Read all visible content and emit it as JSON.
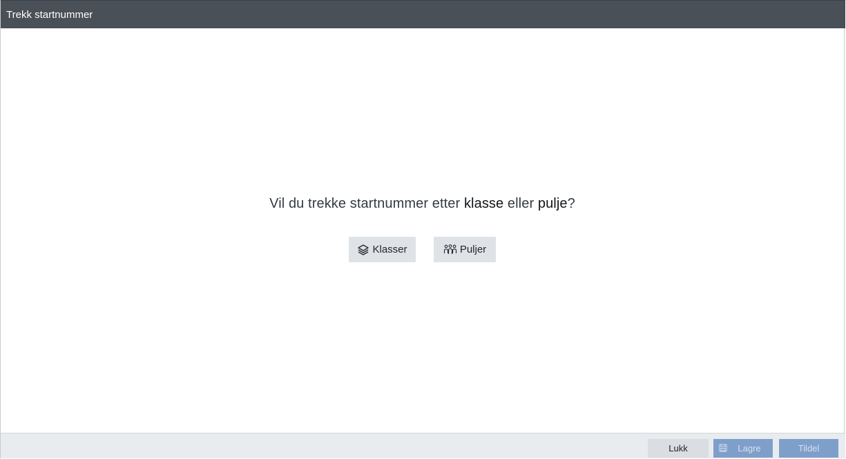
{
  "window": {
    "title": "Trekk startnummer"
  },
  "prompt": {
    "before": "Vil du trekke startnummer etter ",
    "option_a": "klasse",
    "middle": " eller ",
    "option_b": "pulje",
    "after": "?"
  },
  "choices": {
    "classes_label": "Klasser",
    "classes_icon": "layers-icon",
    "pools_label": "Puljer",
    "pools_icon": "group-icon"
  },
  "footer": {
    "close_label": "Lukk",
    "save_label": "Lagre",
    "save_icon": "save-icon",
    "assign_label": "Tildel",
    "disabled_color": "#7f9fcb"
  }
}
